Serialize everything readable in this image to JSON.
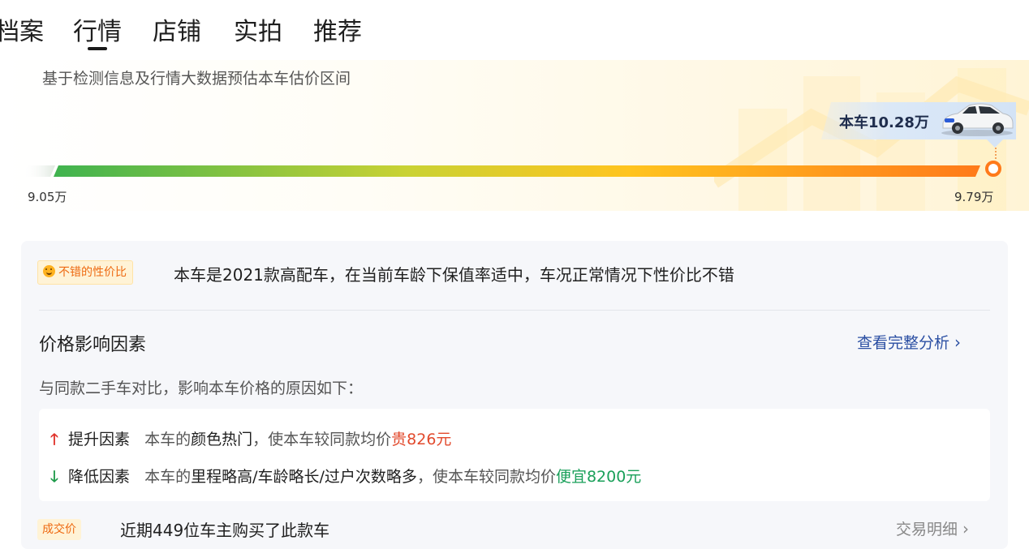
{
  "nav": {
    "tabs": [
      {
        "label": "档案"
      },
      {
        "label": "行情"
      },
      {
        "label": "店铺"
      },
      {
        "label": "实拍"
      },
      {
        "label": "推荐"
      }
    ],
    "active_tab": "行情"
  },
  "estimate": {
    "description": "基于检测信息及行情大数据预估本车估价区间",
    "car_price_label": "本车10.28万",
    "range_min": "9.05万",
    "range_max": "9.79万",
    "gradient_colors": [
      "#3fb34f",
      "#c9d234",
      "#ffc41f",
      "#ff7a1a"
    ],
    "marker_color": "#ff7a1a"
  },
  "summary": {
    "badge_icon": "smile-icon",
    "badge_label": "不错的性价比",
    "text": "本车是2021款高配车，在当前车龄下保值率适中，车况正常情况下性价比不错"
  },
  "factors": {
    "title": "价格影响因素",
    "link_label": "查看完整分析",
    "subtitle": "与同款二手车对比，影响本车价格的原因如下：",
    "up": {
      "icon": "arrow-up-icon",
      "label": "提升因素",
      "prefix": "本车的",
      "highlight": "颜色热门",
      "middle": "，使本车较同款均价",
      "value": "贵826元",
      "color": "#e24a2d"
    },
    "down": {
      "icon": "arrow-down-icon",
      "label": "降低因素",
      "prefix": "本车的",
      "highlight": "里程略高/车龄略长/过户次数略多",
      "middle": "，使本车较同款均价",
      "value": "便宜8200元",
      "color": "#1aa05a"
    }
  },
  "deals": {
    "badge_label": "成交价",
    "text": "近期449位车主购买了此款车",
    "link_label": "交易明细"
  }
}
